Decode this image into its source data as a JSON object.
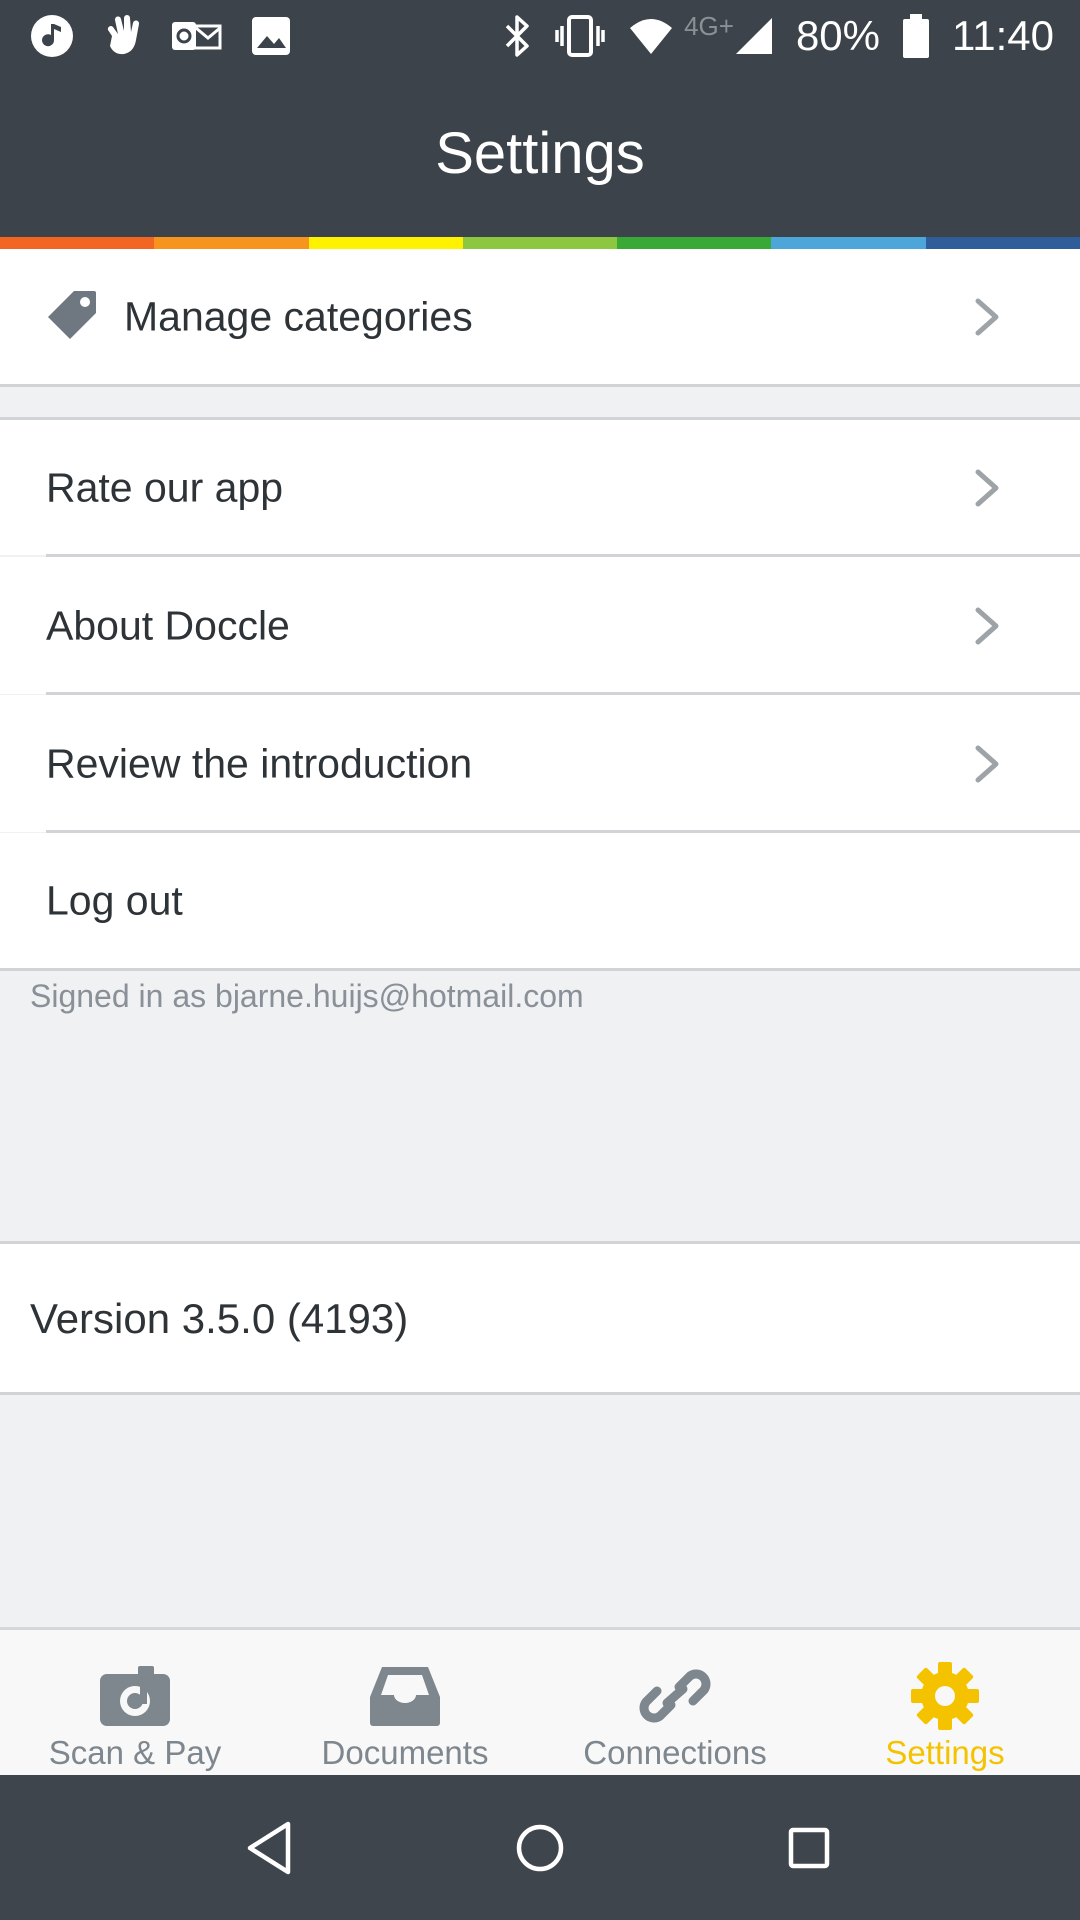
{
  "status_bar": {
    "left_icons": [
      "music-note-icon",
      "hand-wave-icon",
      "outlook-icon",
      "image-icon"
    ],
    "right_icons": [
      "bluetooth-icon",
      "vibrate-icon",
      "wifi-icon",
      "cell-signal-icon",
      "battery-icon"
    ],
    "network_label": "4G+",
    "battery_percent": "80%",
    "time": "11:40"
  },
  "header": {
    "title": "Settings",
    "rainbow_colors": [
      "#f26522",
      "#f7941d",
      "#fff200",
      "#8dc63f",
      "#39a935",
      "#4da6d9",
      "#2f5d99"
    ]
  },
  "settings": {
    "manage_categories": {
      "label": "Manage categories",
      "icon": "tag-icon"
    },
    "items": [
      {
        "label": "Rate our app"
      },
      {
        "label": "About Doccle"
      },
      {
        "label": "Review the introduction"
      }
    ],
    "logout": {
      "label": "Log out"
    },
    "signed_in_text": "Signed in as bjarne.huijs@hotmail.com",
    "version_text": "Version 3.5.0 (4193)"
  },
  "bottom_nav": {
    "items": [
      {
        "label": "Scan & Pay",
        "icon": "camera-doc-icon",
        "active": false
      },
      {
        "label": "Documents",
        "icon": "inbox-tray-icon",
        "active": false
      },
      {
        "label": "Connections",
        "icon": "link-icon",
        "active": false
      },
      {
        "label": "Settings",
        "icon": "gear-icon",
        "active": true
      }
    ],
    "active_color": "#f5c200",
    "inactive_color": "#7e868e"
  },
  "system_nav": {
    "buttons": [
      "back-icon",
      "home-icon",
      "recents-icon"
    ]
  }
}
